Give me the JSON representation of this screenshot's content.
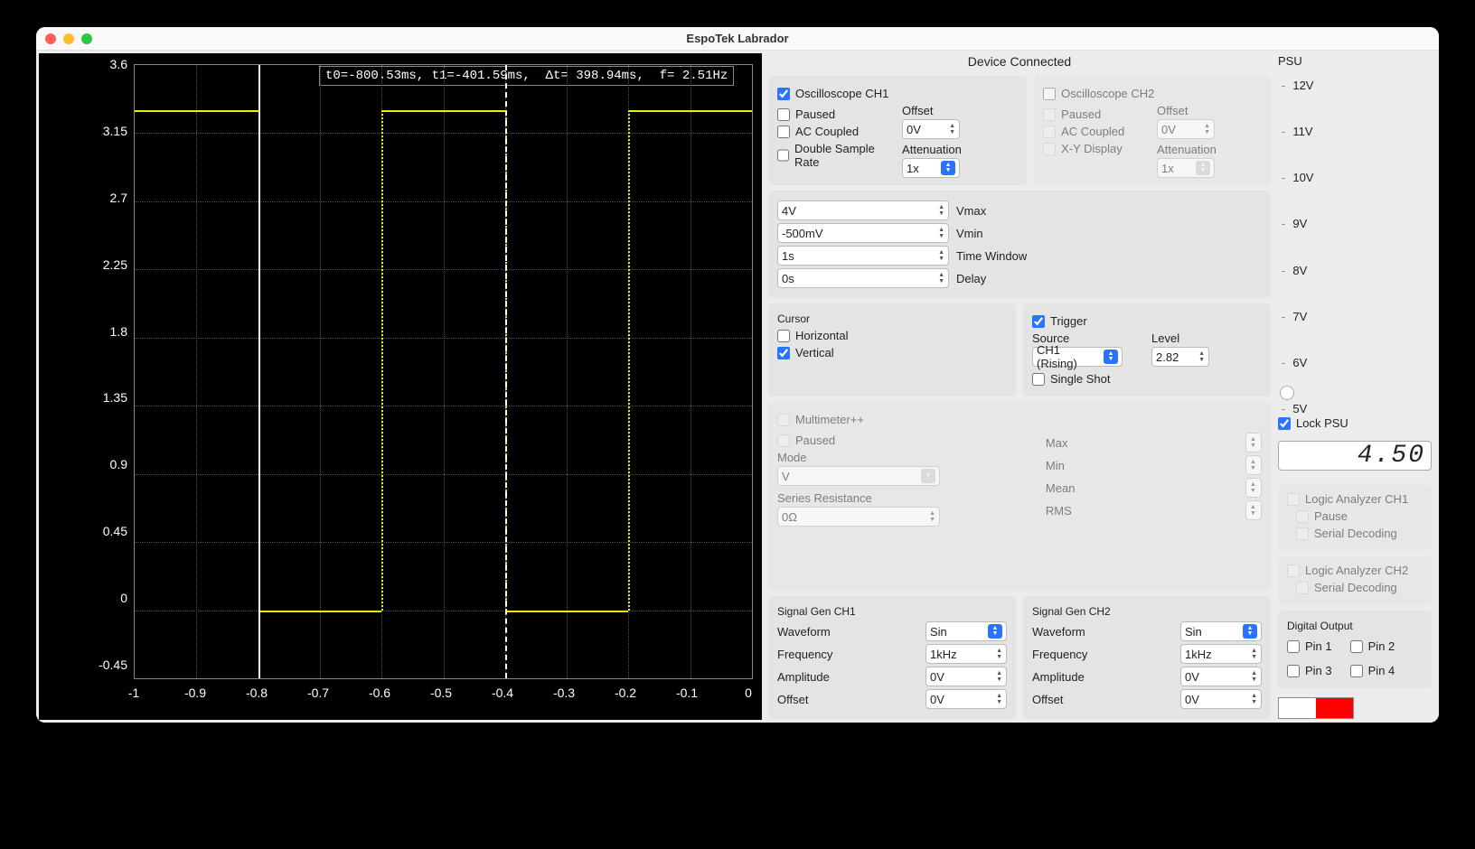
{
  "window": {
    "title": "EspoTek Labrador"
  },
  "status": "Device Connected",
  "cursor_readout": "t0=-800.53ms, t1=-401.59ms,  Δt= 398.94ms,  f= 2.51Hz",
  "chart_data": {
    "type": "line",
    "waveform": "square",
    "high_value": 3.3,
    "low_value": 0.0,
    "x_range": [
      -1,
      0
    ],
    "y_range": [
      -0.45,
      3.6
    ],
    "y_ticks": [
      3.6,
      3.15,
      2.7,
      2.25,
      1.8,
      1.35,
      0.9,
      0.45,
      0,
      -0.45
    ],
    "x_ticks": [
      -1,
      -0.9,
      -0.8,
      -0.7,
      -0.6,
      -0.5,
      -0.4,
      -0.3,
      -0.2,
      -0.1,
      0
    ],
    "cursors": {
      "t0": -0.8,
      "t1": -0.4
    },
    "edges": [
      -0.8,
      -0.6,
      -0.4,
      -0.2
    ]
  },
  "scope": {
    "ch1": {
      "title": "Oscilloscope CH1",
      "enabled": true,
      "paused": "Paused",
      "ac": "AC Coupled",
      "double": "Double Sample Rate",
      "offset_label": "Offset",
      "offset": "0V",
      "atten_label": "Attenuation",
      "atten": "1x"
    },
    "ch2": {
      "title": "Oscilloscope CH2",
      "enabled": false,
      "paused": "Paused",
      "ac": "AC Coupled",
      "xy": "X-Y Display",
      "offset_label": "Offset",
      "offset": "0V",
      "atten_label": "Attenuation",
      "atten": "1x"
    },
    "range": {
      "vmax": "4V",
      "vmax_label": "Vmax",
      "vmin": "-500mV",
      "vmin_label": "Vmin",
      "timewin": "1s",
      "timewin_label": "Time Window",
      "delay": "0s",
      "delay_label": "Delay"
    }
  },
  "cursor": {
    "title": "Cursor",
    "horizontal": "Horizontal",
    "vertical": "Vertical",
    "vertical_on": true
  },
  "trigger": {
    "title": "Trigger",
    "enabled": true,
    "source_label": "Source",
    "source": "CH1 (Rising)",
    "level_label": "Level",
    "level": "2.82",
    "single": "Single Shot"
  },
  "multimeter": {
    "title": "Multimeter++",
    "paused": "Paused",
    "mode_label": "Mode",
    "mode": "V",
    "series_label": "Series Resistance",
    "series": "0Ω",
    "max": "Max",
    "min": "Min",
    "mean": "Mean",
    "rms": "RMS"
  },
  "siggen": {
    "ch1": {
      "title": "Signal Gen CH1",
      "waveform_label": "Waveform",
      "waveform": "Sin",
      "freq_label": "Frequency",
      "freq": "1kHz",
      "amp_label": "Amplitude",
      "amp": "0V",
      "offset_label": "Offset",
      "offset": "0V"
    },
    "ch2": {
      "title": "Signal Gen CH2",
      "waveform_label": "Waveform",
      "waveform": "Sin",
      "freq_label": "Frequency",
      "freq": "1kHz",
      "amp_label": "Amplitude",
      "amp": "0V",
      "offset_label": "Offset",
      "offset": "0V"
    }
  },
  "psu": {
    "title": "PSU",
    "ticks": [
      "12V",
      "11V",
      "10V",
      "9V",
      "8V",
      "7V",
      "6V",
      "5V"
    ],
    "lock": "Lock PSU",
    "lock_on": true,
    "value": "4.50"
  },
  "la": {
    "ch1": {
      "title": "Logic Analyzer CH1",
      "pause": "Pause",
      "serial": "Serial Decoding"
    },
    "ch2": {
      "title": "Logic Analyzer CH2",
      "serial": "Serial Decoding"
    }
  },
  "digital": {
    "title": "Digital Output",
    "pin1": "Pin 1",
    "pin2": "Pin 2",
    "pin3": "Pin 3",
    "pin4": "Pin 4"
  }
}
